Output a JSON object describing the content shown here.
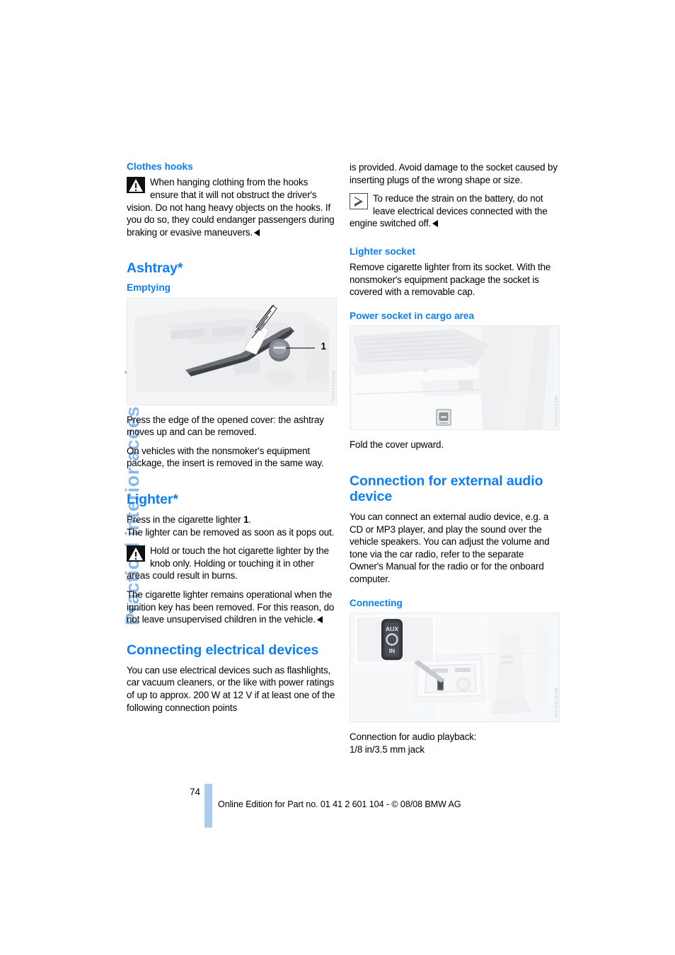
{
  "running_head": "Practical interior accessories",
  "accent_color": "#0d7ef5",
  "running_head_color": "#8cb8e8",
  "left_column": {
    "clothes_hooks": {
      "heading": "Clothes hooks",
      "warning_icon": "warning-triangle-icon",
      "warning_text": "When hanging clothing from the hooks ensure that it will not obstruct the driver's vision. Do not hang heavy objects on the hooks. If you do so, they could endanger passengers during braking or evasive maneuvers."
    },
    "ashtray": {
      "heading": "Ashtray*",
      "subheading": "Emptying",
      "figure": {
        "name": "ashtray-illustration",
        "callout_label": "1",
        "ref_code": "MV0701c54a"
      },
      "paragraph_1": "Press the edge of the opened cover: the ashtray moves up and can be removed.",
      "paragraph_2": "On vehicles with the nonsmoker's equipment package, the insert is removed in the same way."
    },
    "lighter": {
      "heading": "Lighter*",
      "paragraph_1_pre": "Press in the cigarette lighter ",
      "paragraph_1_bold": "1",
      "paragraph_1_post": ".",
      "paragraph_2": "The lighter can be removed as soon as it pops out.",
      "warning_icon": "warning-triangle-icon",
      "warning_text": "Hold or touch the hot cigarette lighter by the knob only. Holding or touching it in other areas could result in burns.",
      "paragraph_3": "The cigarette lighter remains operational when the ignition key has been removed. For this reason, do not leave unsupervised children in the vehicle."
    },
    "connecting_electrical_devices": {
      "heading": "Connecting electrical devices",
      "paragraph_1": "You can use electrical devices such as flashlights, car vacuum cleaners, or the like with power ratings of up to approx. 200 W at 12 V if at least one of the following connection points"
    }
  },
  "right_column": {
    "continuation": {
      "paragraph_1": "is provided. Avoid damage to the socket caused by inserting plugs of the wrong shape or size.",
      "note_icon": "play-triangle-icon",
      "note_text": "To reduce the strain on the battery, do not leave electrical devices connected with the engine switched off."
    },
    "lighter_socket": {
      "heading": "Lighter socket",
      "paragraph_1": "Remove cigarette lighter from its socket. With the nonsmoker's equipment package the socket is covered with a removable cap."
    },
    "power_socket": {
      "heading": "Power socket in cargo area",
      "figure": {
        "name": "cargo-area-power-socket-illustration",
        "ref_code": "MV0701c34A"
      },
      "caption": "Fold the cover upward."
    },
    "external_audio": {
      "heading": "Connection for external audio device",
      "paragraph_1": "You can connect an external audio device, e.g. a CD or MP3 player, and play the sound over the vehicle speakers. You can adjust the volume and tone via the car radio, refer to the separate Owner's Manual for the radio or for the onboard computer.",
      "subheading": "Connecting",
      "figure": {
        "name": "aux-in-jack-illustration",
        "detail_label_line1": "AUX",
        "detail_label_line2": "IN",
        "ref_code": "MV0701c24A"
      },
      "caption_line1": "Connection for audio playback:",
      "caption_line2": "1/8 in/3.5 mm jack"
    }
  },
  "footer": {
    "page_number": "74",
    "edition_text": "Online Edition for Part no. 01 41 2 601 104 - © 08/08 BMW AG"
  }
}
